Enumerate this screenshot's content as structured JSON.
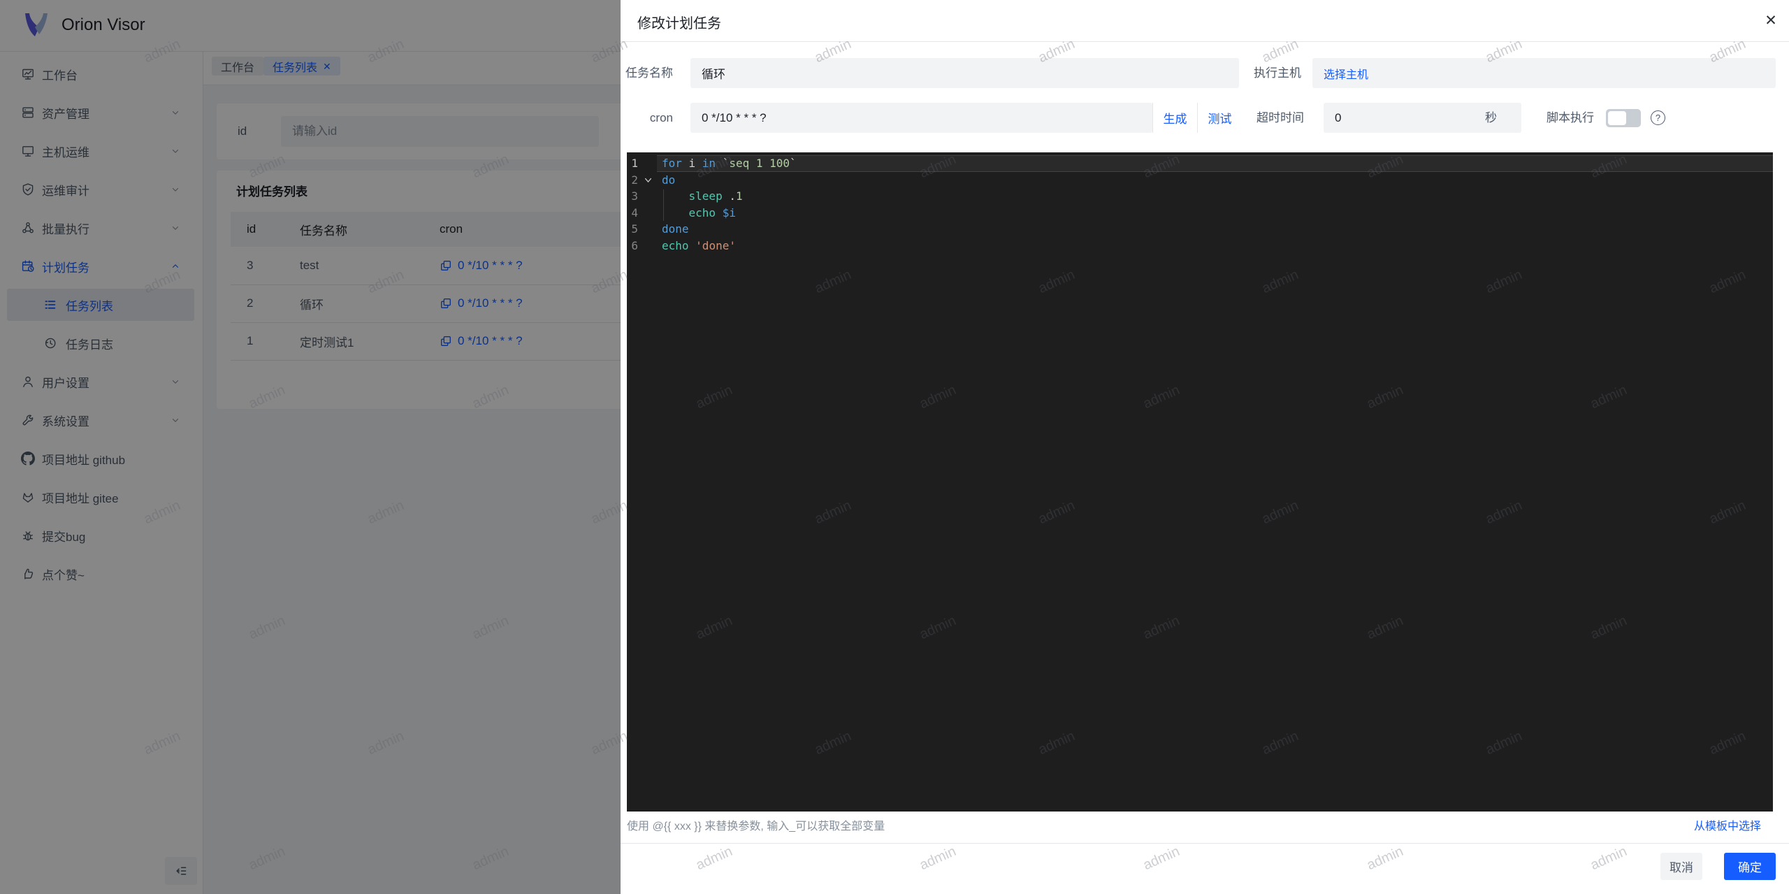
{
  "app": {
    "logo_title": "Orion Visor"
  },
  "sidebar": {
    "items": [
      {
        "label": "工作台"
      },
      {
        "label": "资产管理"
      },
      {
        "label": "主机运维"
      },
      {
        "label": "运维审计"
      },
      {
        "label": "批量执行"
      },
      {
        "label": "计划任务"
      },
      {
        "label": "任务列表"
      },
      {
        "label": "任务日志"
      },
      {
        "label": "用户设置"
      },
      {
        "label": "系统设置"
      },
      {
        "label": "项目地址 github"
      },
      {
        "label": "项目地址 gitee"
      },
      {
        "label": "提交bug"
      },
      {
        "label": "点个赞~"
      }
    ]
  },
  "tabs": {
    "tab1": "工作台",
    "tab2": "任务列表",
    "close": "✕"
  },
  "filter": {
    "id_label": "id",
    "id_placeholder": "请输入id"
  },
  "table": {
    "title": "计划任务列表",
    "columns": {
      "id": "id",
      "name": "任务名称",
      "cron": "cron"
    },
    "rows": [
      {
        "id": "3",
        "name": "test",
        "cron": "0 */10 * * * ?"
      },
      {
        "id": "2",
        "name": "循环",
        "cron": "0 */10 * * * ?"
      },
      {
        "id": "1",
        "name": "定时测试1",
        "cron": "0 */10 * * * ?"
      }
    ]
  },
  "modal": {
    "title": "修改计划任务",
    "close": "✕",
    "form": {
      "name_label": "任务名称",
      "name_value": "循环",
      "host_label": "执行主机",
      "host_link": "选择主机",
      "cron_label": "cron",
      "cron_value": "0 */10 * * * ?",
      "generate": "生成",
      "test": "测试",
      "timeout_label": "超时时间",
      "timeout_value": "0",
      "timeout_unit": "秒",
      "script_label": "脚本执行",
      "help": "?"
    },
    "hint": "使用 @{{ xxx }} 来替换参数, 输入_可以获取全部变量",
    "template_link": "从模板中选择",
    "cancel": "取消",
    "ok": "确定"
  },
  "editor": {
    "line_numbers": [
      "1",
      "2",
      "3",
      "4",
      "5",
      "6"
    ],
    "lines": [
      [
        {
          "t": "for "
        },
        {
          "t": "i "
        },
        {
          "t": "in "
        },
        {
          "t": "`"
        },
        {
          "t": "seq 1 100"
        },
        {
          "t": "`"
        }
      ],
      [
        {
          "t": "do"
        }
      ],
      [
        {
          "t": "    "
        },
        {
          "t": "sleep"
        },
        {
          "t": " ."
        },
        {
          "t": "1"
        }
      ],
      [
        {
          "t": "    "
        },
        {
          "t": "echo"
        },
        {
          "t": " "
        },
        {
          "t": "$i"
        }
      ],
      [
        {
          "t": "done"
        }
      ],
      [
        {
          "t": "echo"
        },
        {
          "t": " "
        },
        {
          "t": "'done'"
        }
      ]
    ]
  },
  "watermark": {
    "text": "admin"
  },
  "colors": {
    "accent": "#165dff",
    "editor_bg": "#1e1e1e",
    "keyword": "#569cd6",
    "number": "#b5cea8",
    "builtin": "#4ec9b0",
    "string": "#ce9178"
  }
}
